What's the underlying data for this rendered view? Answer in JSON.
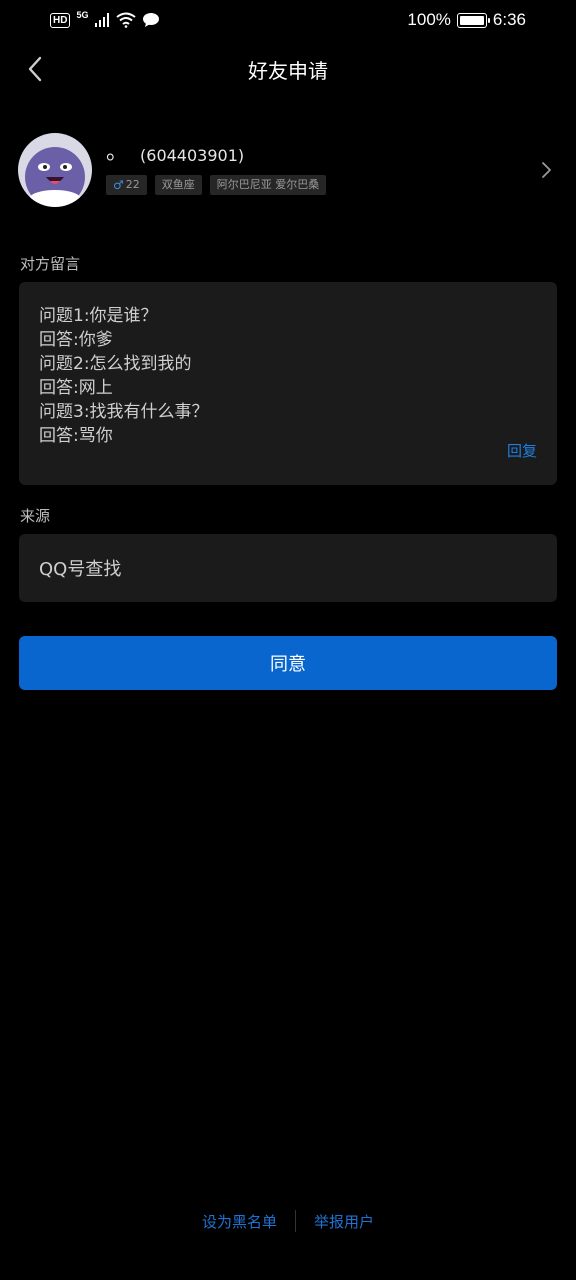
{
  "status_bar": {
    "hd": "HD",
    "network": "5G",
    "battery_percent": "100%",
    "time": "6:36"
  },
  "navbar": {
    "title": "好友申请"
  },
  "profile": {
    "nickname": "。",
    "qq_number": "(604403901)",
    "tags": {
      "age": "22",
      "zodiac": "双鱼座",
      "location": "阿尔巴尼亚  爱尔巴桑"
    }
  },
  "message": {
    "label": "对方留言",
    "lines": [
      "问题1:你是谁？",
      "回答:你爹",
      "问题2:怎么找到我的",
      "回答:网上",
      "问题3:找我有什么事？",
      "回答:骂你"
    ],
    "reply_label": "回复"
  },
  "source": {
    "label": "来源",
    "value": "QQ号查找"
  },
  "actions": {
    "agree_label": "同意",
    "blacklist_label": "设为黑名单",
    "report_label": "举报用户"
  },
  "colors": {
    "background": "#000000",
    "card": "#1b1b1b",
    "primary_button": "#0a66cf",
    "link": "#1e73d2",
    "male_icon": "#3a8de0"
  }
}
